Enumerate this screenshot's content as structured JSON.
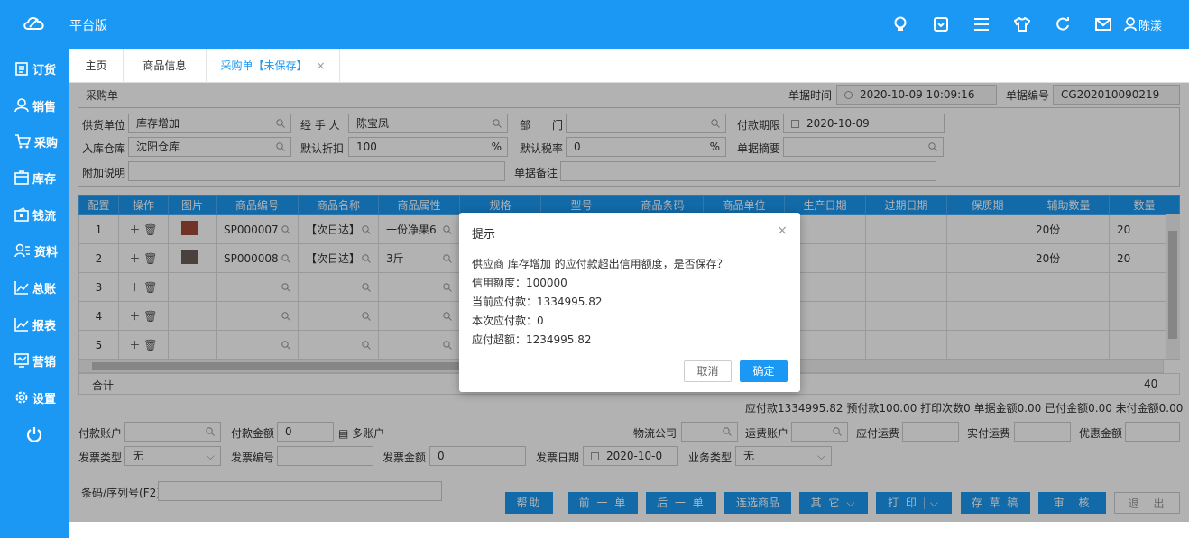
{
  "topbar": {
    "brand": "平台版",
    "user": "陈漾"
  },
  "sidebar": [
    {
      "label": "订货",
      "icon": "clipboard-icon"
    },
    {
      "label": "销售",
      "icon": "user-icon"
    },
    {
      "label": "采购",
      "icon": "cart-icon"
    },
    {
      "label": "库存",
      "icon": "box-icon"
    },
    {
      "label": "钱流",
      "icon": "wallet-icon"
    },
    {
      "label": "资料",
      "icon": "contacts-icon"
    },
    {
      "label": "总账",
      "icon": "chart-icon"
    },
    {
      "label": "报表",
      "icon": "report-icon"
    },
    {
      "label": "营销",
      "icon": "marketing-icon"
    },
    {
      "label": "设置",
      "icon": "gear-icon"
    }
  ],
  "tabs": {
    "home": "主页",
    "goods": "商品信息",
    "purchase": "采购单【未保存】"
  },
  "header": {
    "title": "采购单",
    "time_label": "单据时间",
    "time_value": "2020-10-09 10:09:16",
    "no_label": "单据编号",
    "no_value": "CG202010090219"
  },
  "form": {
    "supplier_label": "供货单位",
    "supplier_value": "库存增加",
    "handler_label": "经 手 人",
    "handler_value": "陈宝凤",
    "dept_label": "部　　门",
    "dept_value": "",
    "payterm_label": "付款期限",
    "payterm_value": "2020-10-09",
    "warehouse_label": "入库仓库",
    "warehouse_value": "沈阳仓库",
    "discount_label": "默认折扣",
    "discount_value": "100",
    "pct": "%",
    "tax_label": "默认税率",
    "tax_value": "0",
    "summary_label": "单据摘要",
    "summary_value": "",
    "note_label": "附加说明",
    "note_value": "",
    "remark_label": "单据备注",
    "remark_value": ""
  },
  "table": {
    "headers": [
      "配置",
      "操作",
      "图片",
      "商品编号",
      "商品名称",
      "商品属性",
      "规格",
      "型号",
      "商品条码",
      "商品单位",
      "生产日期",
      "过期日期",
      "保质期",
      "辅助数量",
      "数量"
    ],
    "rows": [
      {
        "idx": "1",
        "code": "SP000007",
        "name": "【次日达】",
        "attr": "一份净果6",
        "aux": "20份",
        "qty": "20"
      },
      {
        "idx": "2",
        "code": "SP000008",
        "name": "【次日达】",
        "attr": "3斤",
        "aux": "20份",
        "qty": "20"
      },
      {
        "idx": "3",
        "code": "",
        "name": "",
        "attr": "",
        "aux": "",
        "qty": ""
      },
      {
        "idx": "4",
        "code": "",
        "name": "",
        "attr": "",
        "aux": "",
        "qty": ""
      },
      {
        "idx": "5",
        "code": "",
        "name": "",
        "attr": "",
        "aux": "",
        "qty": ""
      }
    ],
    "total_label": "合计",
    "total_qty": "40"
  },
  "summary": "应付款1334995.82  预付款100.00  打印次数0  单据金额0.00  已付金额0.00  未付金额0.00",
  "bottom": {
    "pay_account": "付款账户",
    "pay_amount": "付款金额",
    "pay_amount_value": "0",
    "multi": "多账户",
    "logistics": "物流公司",
    "freight_account": "运费账户",
    "freight_payable": "应付运费",
    "freight_actual": "实付运费",
    "discount_amount": "优惠金额",
    "invoice_type": "发票类型",
    "invoice_type_value": "无",
    "invoice_no": "发票编号",
    "invoice_amount": "发票金额",
    "invoice_amount_value": "0",
    "invoice_date": "发票日期",
    "invoice_date_value": "2020-10-0",
    "biz_type": "业务类型",
    "biz_type_value": "无",
    "barcode": "条码/序列号(F2)"
  },
  "buttons": {
    "help": "帮助",
    "prev": "前 一 单",
    "next": "后 一 单",
    "multi": "连选商品",
    "other": "其 它",
    "print": "打 印",
    "draft": "存 草 稿",
    "audit": "审　核",
    "exit": "退　出"
  },
  "modal": {
    "title": "提示",
    "lines": [
      "供应商 库存增加 的应付款超出信用额度，是否保存？",
      "信用额度：100000",
      "当前应付款：1334995.82",
      "本次应付款：0",
      "应付超额：1234995.82"
    ],
    "cancel": "取消",
    "ok": "确定"
  }
}
